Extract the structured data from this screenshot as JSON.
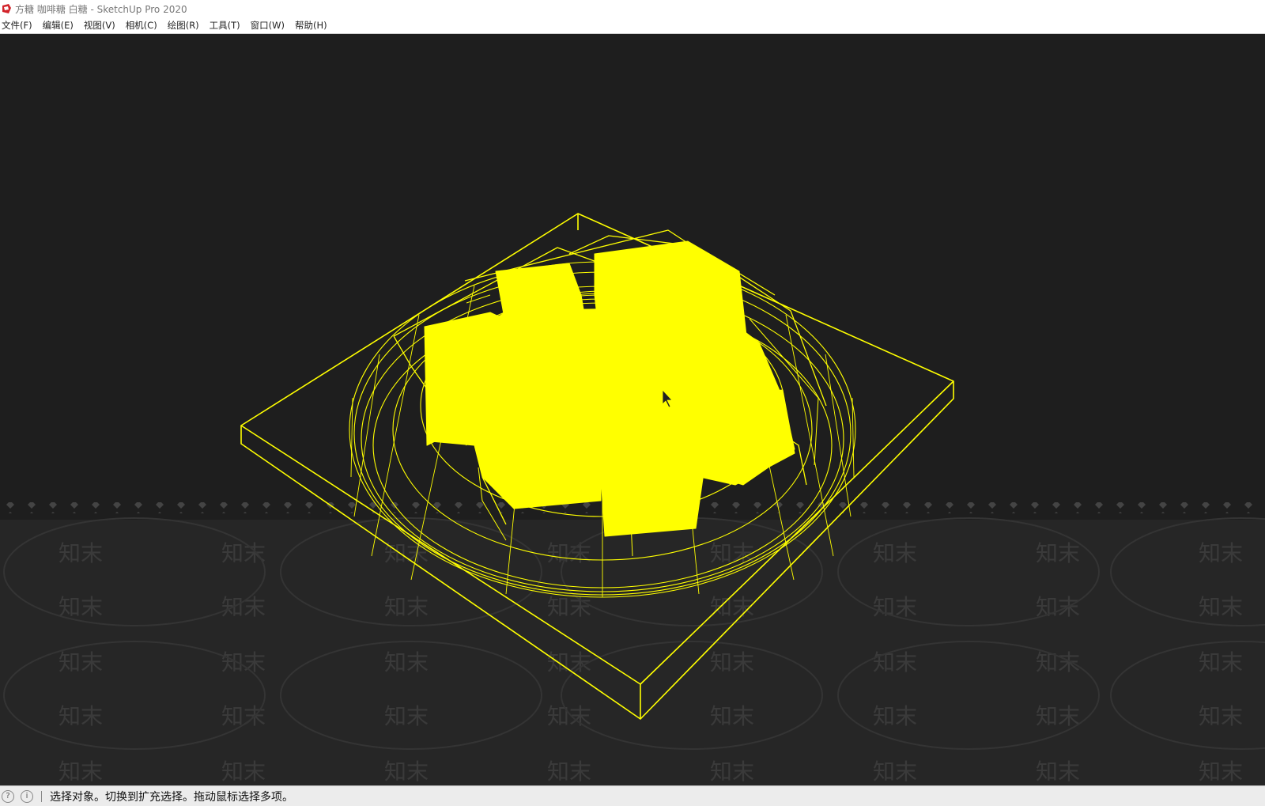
{
  "window": {
    "title": "方糖 咖啡糖 白糖 - SketchUp Pro 2020",
    "icon": "sketchup-logo-icon"
  },
  "menubar": {
    "items": [
      {
        "label": "文件(F)"
      },
      {
        "label": "编辑(E)"
      },
      {
        "label": "视图(V)"
      },
      {
        "label": "相机(C)"
      },
      {
        "label": "绘图(R)"
      },
      {
        "label": "工具(T)"
      },
      {
        "label": "窗口(W)"
      },
      {
        "label": "帮助(H)"
      }
    ]
  },
  "viewport": {
    "background": "#1e1e1e",
    "highlight_color": "#ffff00",
    "watermark_text": "知末"
  },
  "statusbar": {
    "icons": [
      "geo-location-icon",
      "info-icon"
    ],
    "message": "选择对象。切换到扩充选择。拖动鼠标选择多项。"
  }
}
